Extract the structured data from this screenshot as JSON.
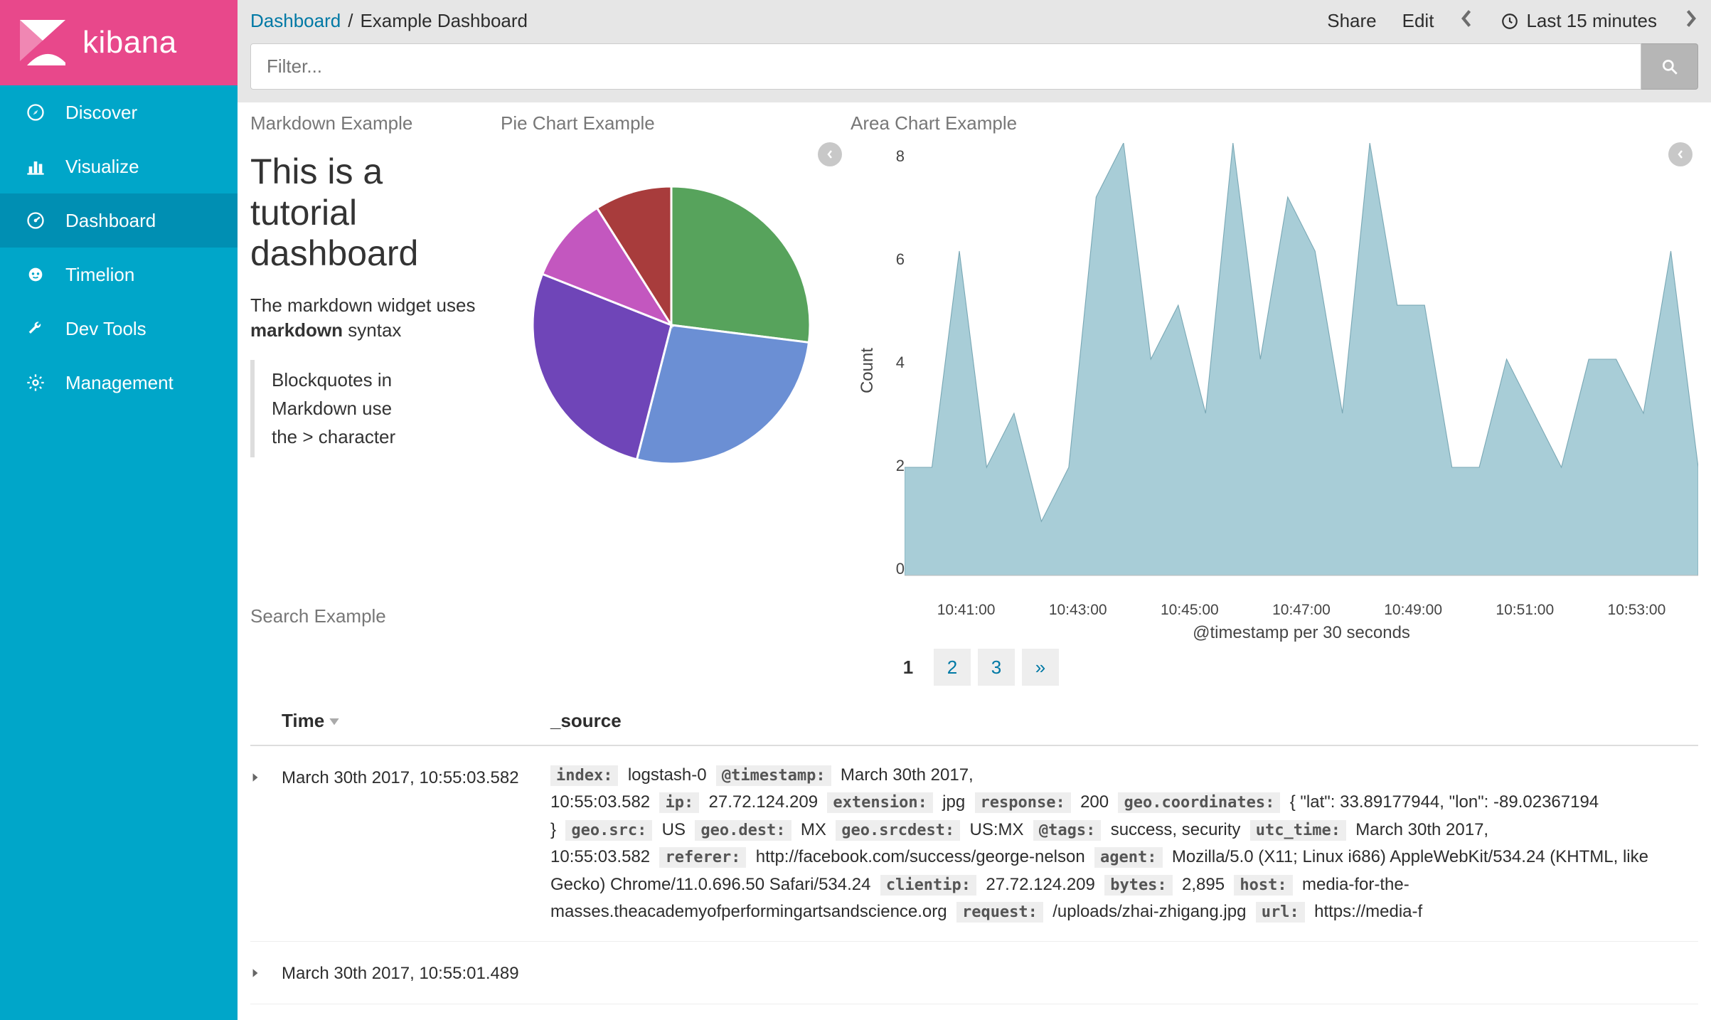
{
  "brand": "kibana",
  "nav": [
    {
      "icon": "compass",
      "label": "Discover"
    },
    {
      "icon": "bar-chart",
      "label": "Visualize"
    },
    {
      "icon": "gauge",
      "label": "Dashboard",
      "active": true
    },
    {
      "icon": "lion",
      "label": "Timelion"
    },
    {
      "icon": "wrench",
      "label": "Dev Tools"
    },
    {
      "icon": "gear",
      "label": "Management"
    }
  ],
  "breadcrumb": {
    "root": "Dashboard",
    "sep": "/",
    "current": "Example Dashboard"
  },
  "actions": {
    "share": "Share",
    "edit": "Edit",
    "time_label": "Last 15 minutes"
  },
  "filter": {
    "placeholder": "Filter..."
  },
  "panels": {
    "markdown": {
      "title": "Markdown Example",
      "h1": "This is a tutorial dashboard",
      "p_pre": "The markdown widget uses ",
      "p_bold": "markdown",
      "p_post": " syntax",
      "bq": "Blockquotes in Markdown use the > character"
    },
    "pie": {
      "title": "Pie Chart Example"
    },
    "area": {
      "title": "Area Chart Example",
      "ylabel": "Count",
      "xlabel": "@timestamp per 30 seconds"
    },
    "search": {
      "title": "Search Example"
    }
  },
  "chart_data": [
    {
      "type": "pie",
      "title": "Pie Chart Example",
      "slices": [
        {
          "label": "green",
          "value": 27,
          "color": "#57a35c"
        },
        {
          "label": "blue",
          "value": 27,
          "color": "#6b8fd4"
        },
        {
          "label": "purple",
          "value": 27,
          "color": "#6f45b8"
        },
        {
          "label": "magenta",
          "value": 10,
          "color": "#c357bf"
        },
        {
          "label": "red",
          "value": 9,
          "color": "#a83c3c"
        }
      ]
    },
    {
      "type": "area",
      "title": "Area Chart Example",
      "ylabel": "Count",
      "xlabel": "@timestamp per 30 seconds",
      "ylim": [
        0,
        8
      ],
      "yticks": [
        0,
        2,
        4,
        6,
        8
      ],
      "xticks": [
        "10:41:00",
        "10:43:00",
        "10:45:00",
        "10:47:00",
        "10:49:00",
        "10:51:00",
        "10:53:00"
      ],
      "x": [
        0,
        1,
        2,
        3,
        4,
        5,
        6,
        7,
        8,
        9,
        10,
        11,
        12,
        13,
        14,
        15,
        16,
        17,
        18,
        19,
        20,
        21,
        22,
        23,
        24,
        25,
        26,
        27,
        28,
        29
      ],
      "values": [
        2,
        2,
        6,
        2,
        3,
        1,
        2,
        7,
        8,
        4,
        5,
        3,
        8,
        4,
        7,
        6,
        3,
        8,
        5,
        5,
        2,
        2,
        4,
        3,
        2,
        4,
        4,
        3,
        6,
        2
      ],
      "color": "#a8cdd7"
    }
  ],
  "pager": {
    "pages": [
      "1",
      "2",
      "3"
    ],
    "next": "»",
    "active": 0
  },
  "table": {
    "columns": {
      "time": "Time",
      "source": "_source"
    },
    "rows": [
      {
        "time": "March 30th 2017, 10:55:03.582",
        "kv": [
          {
            "k": "index:",
            "v": "logstash-0"
          },
          {
            "k": "@timestamp:",
            "v": "March 30th 2017, 10:55:03.582"
          },
          {
            "k": "ip:",
            "v": "27.72.124.209"
          },
          {
            "k": "extension:",
            "v": "jpg"
          },
          {
            "k": "response:",
            "v": "200"
          },
          {
            "k": "geo.coordinates:",
            "v": "{ \"lat\": 33.89177944, \"lon\": -89.02367194 }"
          },
          {
            "k": "geo.src:",
            "v": "US"
          },
          {
            "k": "geo.dest:",
            "v": "MX"
          },
          {
            "k": "geo.srcdest:",
            "v": "US:MX"
          },
          {
            "k": "@tags:",
            "v": "success, security"
          },
          {
            "k": "utc_time:",
            "v": "March 30th 2017, 10:55:03.582"
          },
          {
            "k": "referer:",
            "v": "http://facebook.com/success/george-nelson"
          },
          {
            "k": "agent:",
            "v": "Mozilla/5.0 (X11; Linux i686) AppleWebKit/534.24 (KHTML, like Gecko) Chrome/11.0.696.50 Safari/534.24"
          },
          {
            "k": "clientip:",
            "v": "27.72.124.209"
          },
          {
            "k": "bytes:",
            "v": "2,895"
          },
          {
            "k": "host:",
            "v": "media-for-the-masses.theacademyofperformingartsandscience.org"
          },
          {
            "k": "request:",
            "v": "/uploads/zhai-zhigang.jpg"
          },
          {
            "k": "url:",
            "v": "https://media-f"
          }
        ]
      },
      {
        "time": "March 30th 2017, 10:55:01.489",
        "kv": []
      }
    ]
  }
}
